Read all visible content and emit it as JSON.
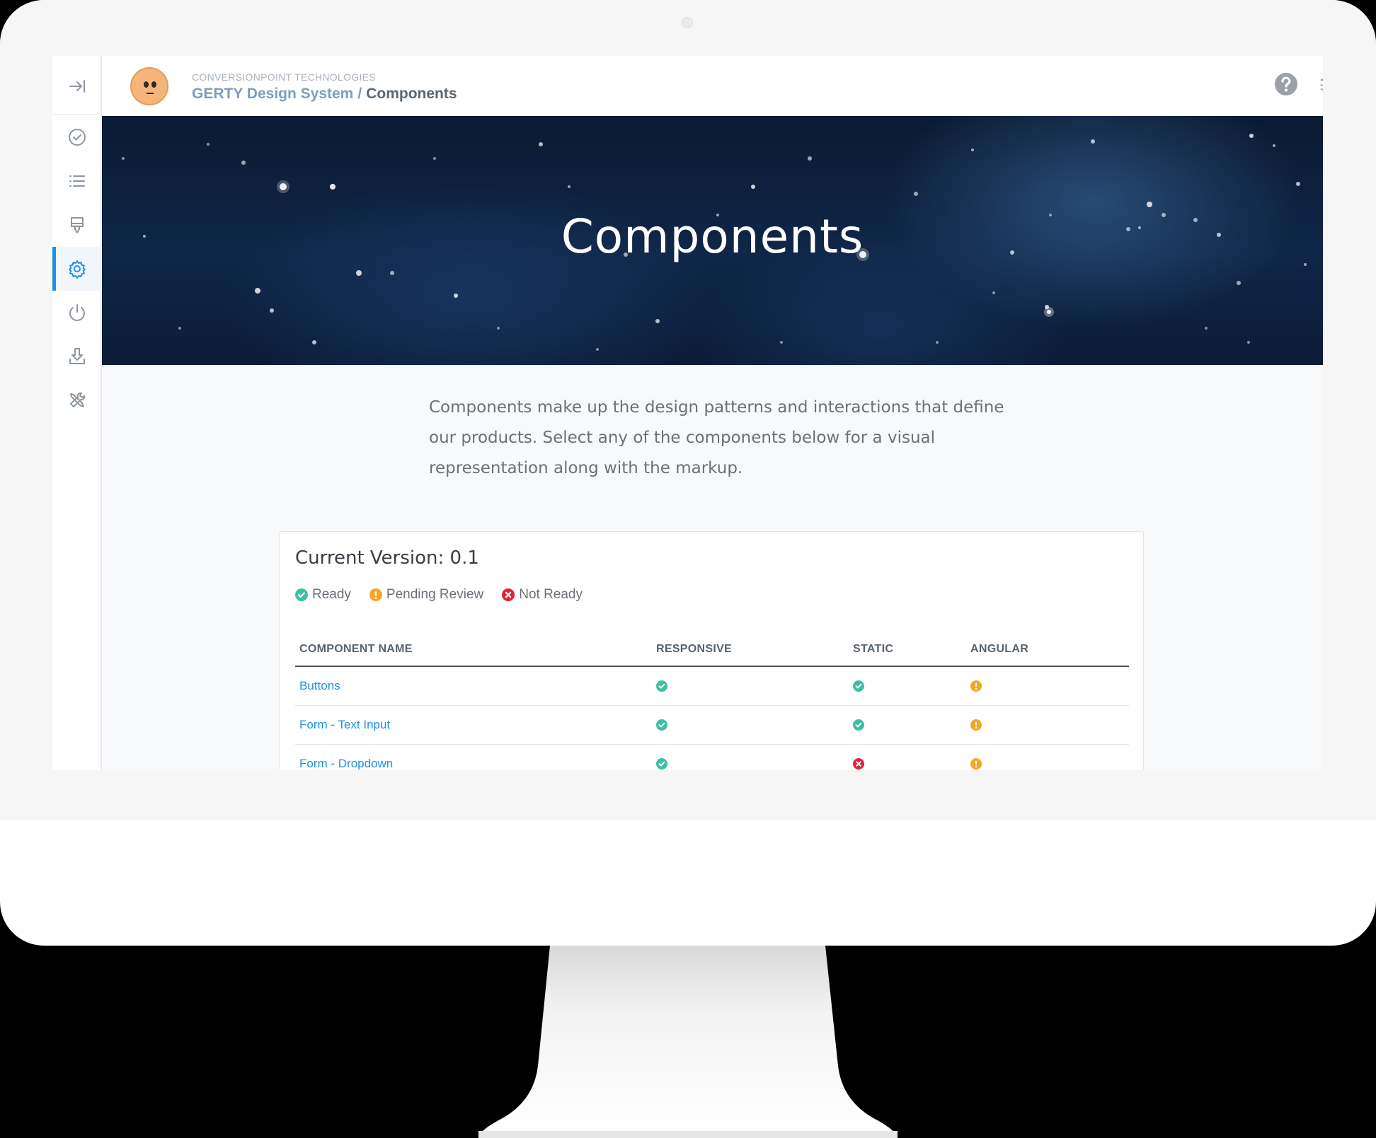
{
  "header": {
    "company": "CONVERSIONPOINT TECHNOLOGIES",
    "breadcrumb_parent": "GERTY Design System",
    "breadcrumb_separator": "/",
    "breadcrumb_current": "Components",
    "icons": [
      "help-icon",
      "layers-icon"
    ]
  },
  "sidebar": {
    "collapse_icon": "collapse-arrow-icon",
    "items": [
      {
        "icon": "check-circle-icon",
        "active": false
      },
      {
        "icon": "list-icon",
        "active": false
      },
      {
        "icon": "brush-icon",
        "active": false
      },
      {
        "icon": "gear-icon",
        "active": true
      },
      {
        "icon": "power-icon",
        "active": false
      },
      {
        "icon": "download-icon",
        "active": false
      },
      {
        "icon": "tools-icon",
        "active": false
      }
    ]
  },
  "hero": {
    "title": "Components"
  },
  "intro": {
    "text": "Components make up the design patterns and interactions that define our products. Select any of the components below for a visual representation along with the markup."
  },
  "card": {
    "title": "Current Version: 0.1",
    "legend": [
      {
        "label": "Ready",
        "status": "ready"
      },
      {
        "label": "Pending Review",
        "status": "pending"
      },
      {
        "label": "Not Ready",
        "status": "not-ready"
      }
    ],
    "columns": [
      "COMPONENT NAME",
      "RESPONSIVE",
      "STATIC",
      "ANGULAR"
    ],
    "rows": [
      {
        "name": "Buttons",
        "responsive": "ready",
        "static": "ready",
        "angular": "pending"
      },
      {
        "name": "Form - Text Input",
        "responsive": "ready",
        "static": "ready",
        "angular": "pending"
      },
      {
        "name": "Form - Dropdown",
        "responsive": "ready",
        "static": "not-ready",
        "angular": "pending"
      }
    ]
  },
  "colors": {
    "accent": "#1e90e6",
    "ready": "#3dbfa3",
    "pending": "#f5a623",
    "not_ready": "#e0233e"
  }
}
